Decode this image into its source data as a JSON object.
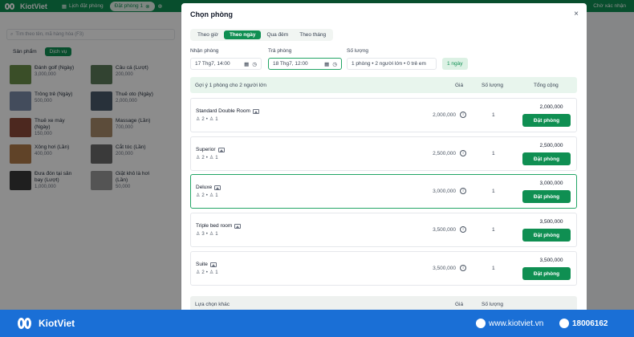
{
  "topbar": {
    "brand": "KiotViet",
    "tab_schedule": "Lịch đặt phòng",
    "tab_active": "Đặt phòng 1",
    "waiting": "Chờ xác nhận"
  },
  "left": {
    "search_placeholder": "Tìm theo tên, mã hàng hóa (F3)",
    "categories": [
      "Sản phẩm",
      "Dịch vụ"
    ],
    "products": [
      {
        "name": "Đánh golf (Ngày)",
        "price": "3,000,000",
        "color": "#6b8f4a"
      },
      {
        "name": "Câu cá (Lượt)",
        "price": "200,000",
        "color": "#5c7a5a"
      },
      {
        "name": "Trông trẻ (Ngày)",
        "price": "500,000",
        "color": "#7a8aa8"
      },
      {
        "name": "Thuê oto (Ngày)",
        "price": "2,000,000",
        "color": "#4a5a6a"
      },
      {
        "name": "Thuê xe máy",
        "name2": "(Ngày)",
        "price": "150,000",
        "color": "#8a4a3a"
      },
      {
        "name": "Massage (Lần)",
        "price": "700,000",
        "color": "#a88a6a"
      },
      {
        "name": "Xông hơi (Lần)",
        "price": "400,000",
        "color": "#b07a4a"
      },
      {
        "name": "Cắt tóc (Lần)",
        "price": "200,000",
        "color": "#6a6a6a"
      },
      {
        "name": "Đưa đón tại sân",
        "name2": "bay (Lượt)",
        "price": "1,000,000",
        "color": "#3a3a3a"
      },
      {
        "name": "Giặt khô là hơi",
        "name2": "(Lần)",
        "price": "50,000",
        "color": "#9a9a9a"
      }
    ]
  },
  "modal": {
    "title": "Chọn phòng",
    "close": "×",
    "modes": [
      "Theo giờ",
      "Theo ngày",
      "Qua đêm",
      "Theo tháng"
    ],
    "checkin_label": "Nhận phòng",
    "checkin_value": "17 Thg7, 14:00",
    "checkout_label": "Trả phòng",
    "checkout_value": "18 Thg7, 12:00",
    "qty_label": "Số lượng",
    "qty_value": "1 phòng • 2 người lớn • 0 trẻ em",
    "days_badge": "1 ngày",
    "table_header": {
      "suggestion": "Gợi ý 1 phòng cho 2 người lớn",
      "price": "Giá",
      "quantity": "Số lượng",
      "total": "Tổng cộng"
    },
    "rooms": [
      {
        "name": "Standard Double Room",
        "adults": "2",
        "children": "1",
        "price": "2,000,000",
        "qty": "1",
        "total": "2,000,000",
        "action": "Đặt phòng"
      },
      {
        "name": "Superior",
        "adults": "2",
        "children": "1",
        "price": "2,500,000",
        "qty": "1",
        "total": "2,500,000",
        "action": "Đặt phòng"
      },
      {
        "name": "Deluxe",
        "adults": "2",
        "children": "1",
        "price": "3,000,000",
        "qty": "1",
        "total": "3,000,000",
        "action": "Đặt phòng"
      },
      {
        "name": "Triple bed room",
        "adults": "3",
        "children": "1",
        "price": "3,500,000",
        "qty": "1",
        "total": "3,500,000",
        "action": "Đặt phòng"
      },
      {
        "name": "Suite",
        "adults": "2",
        "children": "1",
        "price": "3,500,000",
        "qty": "1",
        "total": "3,500,000",
        "action": "Đặt phòng"
      }
    ],
    "other_header": {
      "label": "Lựa chọn khác",
      "price": "Giá",
      "quantity": "Số lượng"
    }
  },
  "banner": {
    "brand": "KiotViet",
    "website": "www.kiotviet.vn",
    "phone": "18006162"
  }
}
